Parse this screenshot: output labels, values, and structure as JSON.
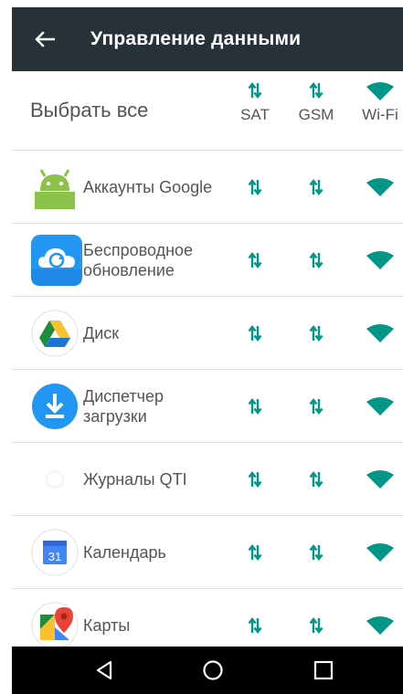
{
  "header": {
    "title": "Управление данными"
  },
  "columns": {
    "select_all": "Выбрать все",
    "sat": "SAT",
    "gsm": "GSM",
    "wifi": "Wi-Fi"
  },
  "apps": [
    {
      "name": "Аккаунты Google",
      "icon": "android-icon"
    },
    {
      "name": "Беспроводное обновление",
      "icon": "cloud-update-icon"
    },
    {
      "name": "Диск",
      "icon": "drive-icon"
    },
    {
      "name": "Диспетчер загрузки",
      "icon": "download-icon"
    },
    {
      "name": "Журналы QTI",
      "icon": "qti-logs-icon"
    },
    {
      "name": "Календарь",
      "icon": "calendar-icon",
      "icon_text": "31"
    },
    {
      "name": "Карты",
      "icon": "maps-icon"
    }
  ],
  "navigation": {
    "back": "back-icon",
    "home": "home-icon",
    "recents": "recents-icon"
  },
  "colors": {
    "appbar": "#263238",
    "accent": "#009688",
    "text": "#555555",
    "navbar": "#000000"
  }
}
